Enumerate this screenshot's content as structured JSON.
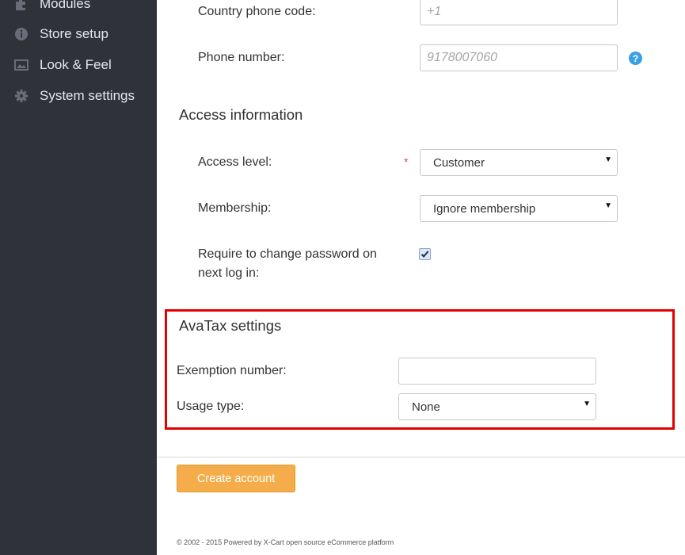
{
  "sidebar": {
    "items": [
      {
        "label": "Modules",
        "icon": "puzzle-icon"
      },
      {
        "label": "Store setup",
        "icon": "info-icon"
      },
      {
        "label": "Look & Feel",
        "icon": "image-icon"
      },
      {
        "label": "System settings",
        "icon": "gear-icon"
      }
    ]
  },
  "form": {
    "country_phone_code": {
      "label": "Country phone code:",
      "placeholder": "+1"
    },
    "phone_number": {
      "label": "Phone number:",
      "placeholder": "9178007060",
      "help": "?"
    },
    "access_section_title": "Access information",
    "access_level": {
      "label": "Access level:",
      "required_mark": "*",
      "value": "Customer"
    },
    "membership": {
      "label": "Membership:",
      "value": "Ignore membership"
    },
    "require_password": {
      "label_line1": "Require to change password on",
      "label_line2": "next log in:",
      "checked": true
    },
    "avatax_section_title": "AvaTax settings",
    "exemption_number": {
      "label": "Exemption number:",
      "value": ""
    },
    "usage_type": {
      "label": "Usage type:",
      "value": "None"
    },
    "arrow_glyph": "▼"
  },
  "actions": {
    "create_account_label": "Create account"
  },
  "footer": {
    "text": "© 2002 - 2015 Powered by X-Cart open source eCommerce platform"
  },
  "colors": {
    "sidebar_bg": "#30323a",
    "highlight": "#e30000",
    "button_bg": "#f4ad4a",
    "help_icon": "#3aa0e4"
  }
}
